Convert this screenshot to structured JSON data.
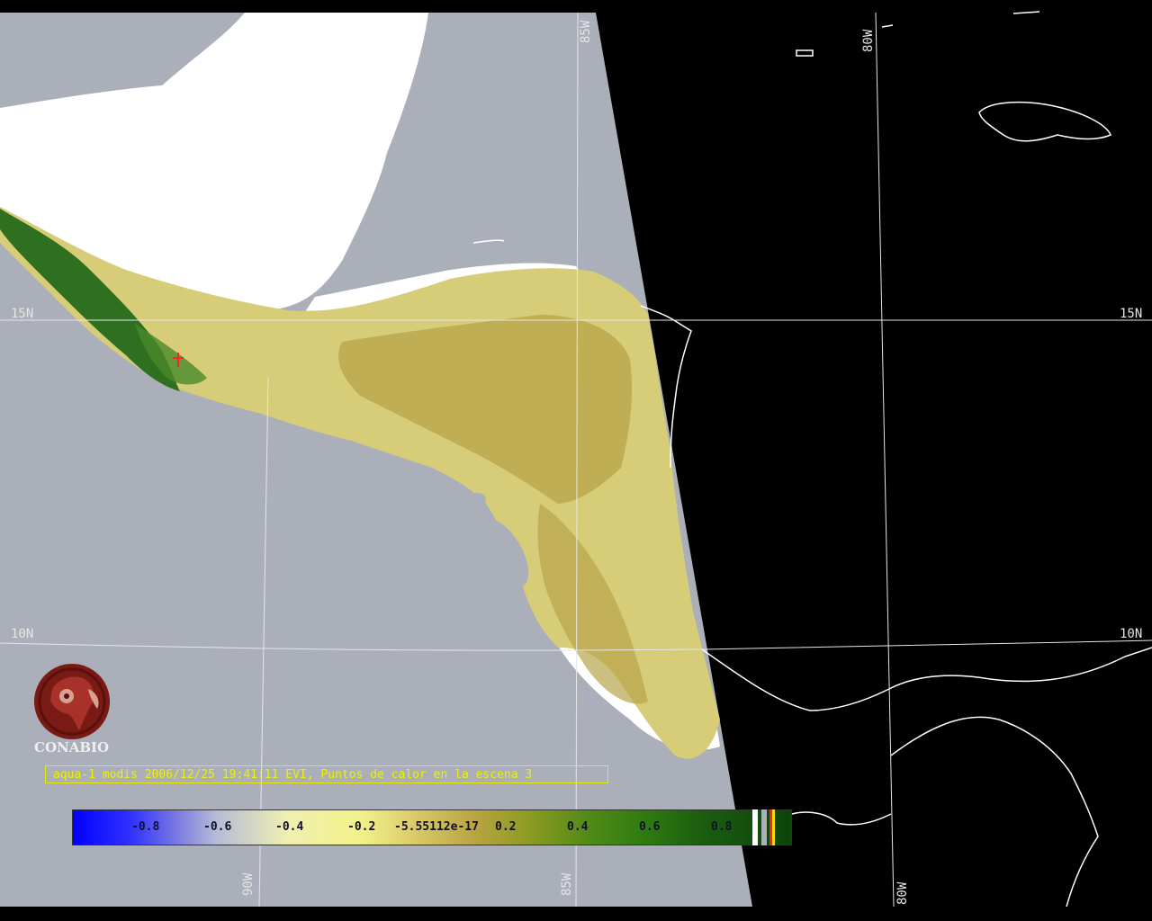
{
  "caption": "aqua-1 modis 2006/12/25 19:41:11 EVI, Puntos de calor en la escena 3",
  "logo": {
    "text": "CONABIO",
    "icon": "conabio-macaw-logo"
  },
  "grid_labels": {
    "lon_85w": "85W",
    "lon_80w": "80W",
    "lon_90w": "90W",
    "lat_15n": "15N",
    "lat_10n": "10N"
  },
  "colorbar": {
    "ticks": [
      "-0.8",
      "-0.6",
      "-0.4",
      "-0.2",
      "-5.55112e-17",
      "0.2",
      "0.4",
      "0.6",
      "0.8"
    ]
  },
  "colors": {
    "ocean": "#abafb9",
    "night_side": "#000000",
    "cloud": "#ffffff",
    "grid": "#e6e6e6",
    "caption": "#f0f000",
    "hotspot": "#ff2020"
  }
}
